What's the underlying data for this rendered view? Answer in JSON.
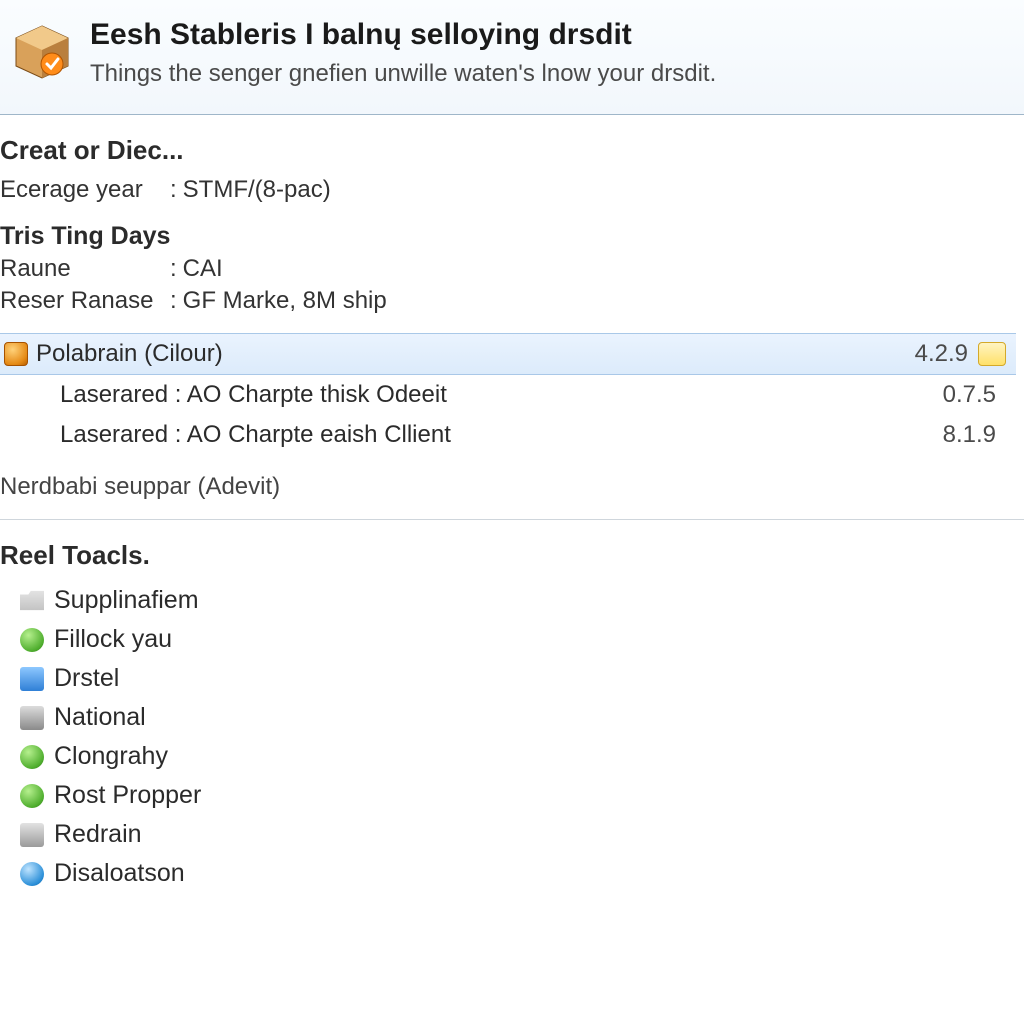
{
  "header": {
    "title": "Eesh Stableris I balnų selloying drsdit",
    "subtitle": "Things the senger gnefien unwille waten's lnow your drsdit."
  },
  "section_creat": {
    "title": "Creat or Diec...",
    "ecerage_label": "Ecerage year",
    "ecerage_value": "STMF/(8-pac)",
    "tris_heading": "Tris Ting Days",
    "raune_label": "Raune",
    "raune_value": "CAI",
    "reser_label": "Reser Ranase",
    "reser_value": "GF Marke, 8M ship",
    "packages": [
      {
        "name": "Polabrain (Cilour)",
        "version": "4.2.9",
        "selected": true,
        "has_button": true,
        "icon": "orange"
      },
      {
        "name": "Laserared : AO Charpte thisk Odeeit",
        "version": "0.7.5",
        "selected": false,
        "has_button": false,
        "icon": ""
      },
      {
        "name": "Laserared : AO Charpte eaish Cllient",
        "version": "8.1.9",
        "selected": false,
        "has_button": false,
        "icon": ""
      }
    ],
    "footnote": "Nerdbabi seuppar (Adevit)"
  },
  "tools": {
    "title": "Reel Toacls.",
    "items": [
      {
        "label": "Supplinafiem",
        "icon": "ic-folder"
      },
      {
        "label": "Fillock yau",
        "icon": "ic-green"
      },
      {
        "label": "Drstel",
        "icon": "ic-blue-sq"
      },
      {
        "label": "National",
        "icon": "ic-grey-sq"
      },
      {
        "label": "Clongrahy",
        "icon": "ic-green"
      },
      {
        "label": "Rost Propper",
        "icon": "ic-green"
      },
      {
        "label": "Redrain",
        "icon": "ic-grey"
      },
      {
        "label": "Disaloatson",
        "icon": "ic-blue-rd"
      }
    ]
  }
}
